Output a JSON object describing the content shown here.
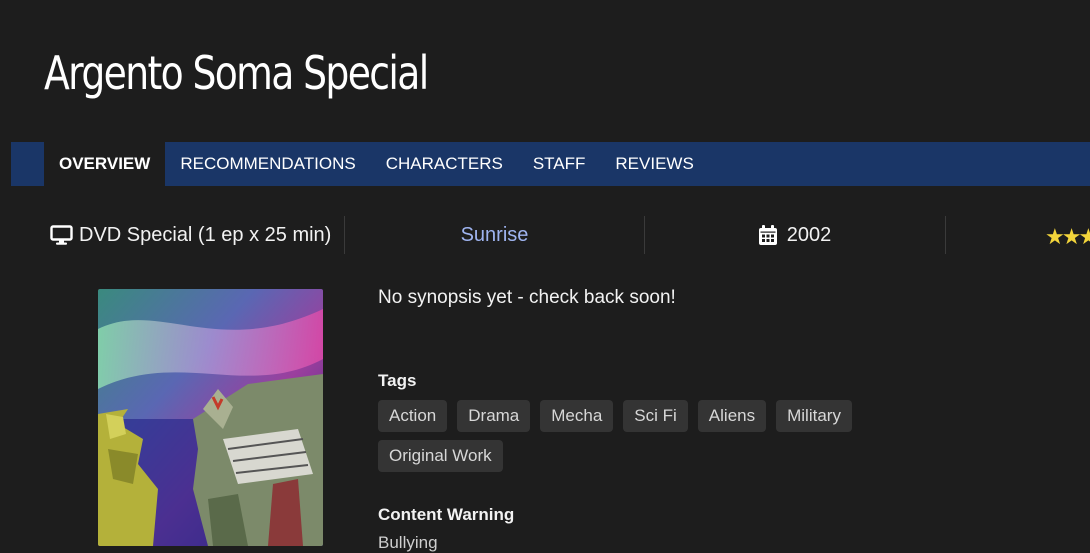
{
  "page": {
    "title": "Argento Soma Special"
  },
  "nav": {
    "tabs": [
      {
        "label": "OVERVIEW",
        "active": true
      },
      {
        "label": "RECOMMENDATIONS",
        "active": false
      },
      {
        "label": "CHARACTERS",
        "active": false
      },
      {
        "label": "STAFF",
        "active": false
      },
      {
        "label": "REVIEWS",
        "active": false
      }
    ]
  },
  "info": {
    "format_icon": "monitor-icon",
    "format": "DVD Special (1 ep x 25 min)",
    "studio": "Sunrise",
    "year_icon": "calendar-icon",
    "year": "2002",
    "rating_stars": "★★★"
  },
  "synopsis": "No synopsis yet - check back soon!",
  "tags_section": {
    "heading": "Tags",
    "tags": [
      "Action",
      "Drama",
      "Mecha",
      "Sci Fi",
      "Aliens",
      "Military",
      "Original Work"
    ]
  },
  "warning_section": {
    "heading": "Content Warning",
    "items": [
      "Bullying"
    ]
  },
  "colors": {
    "background": "#1d1d1d",
    "navbar": "#1a3667",
    "link": "#9fb4f0",
    "tag_bg": "#343434",
    "star": "#f3d53b"
  }
}
